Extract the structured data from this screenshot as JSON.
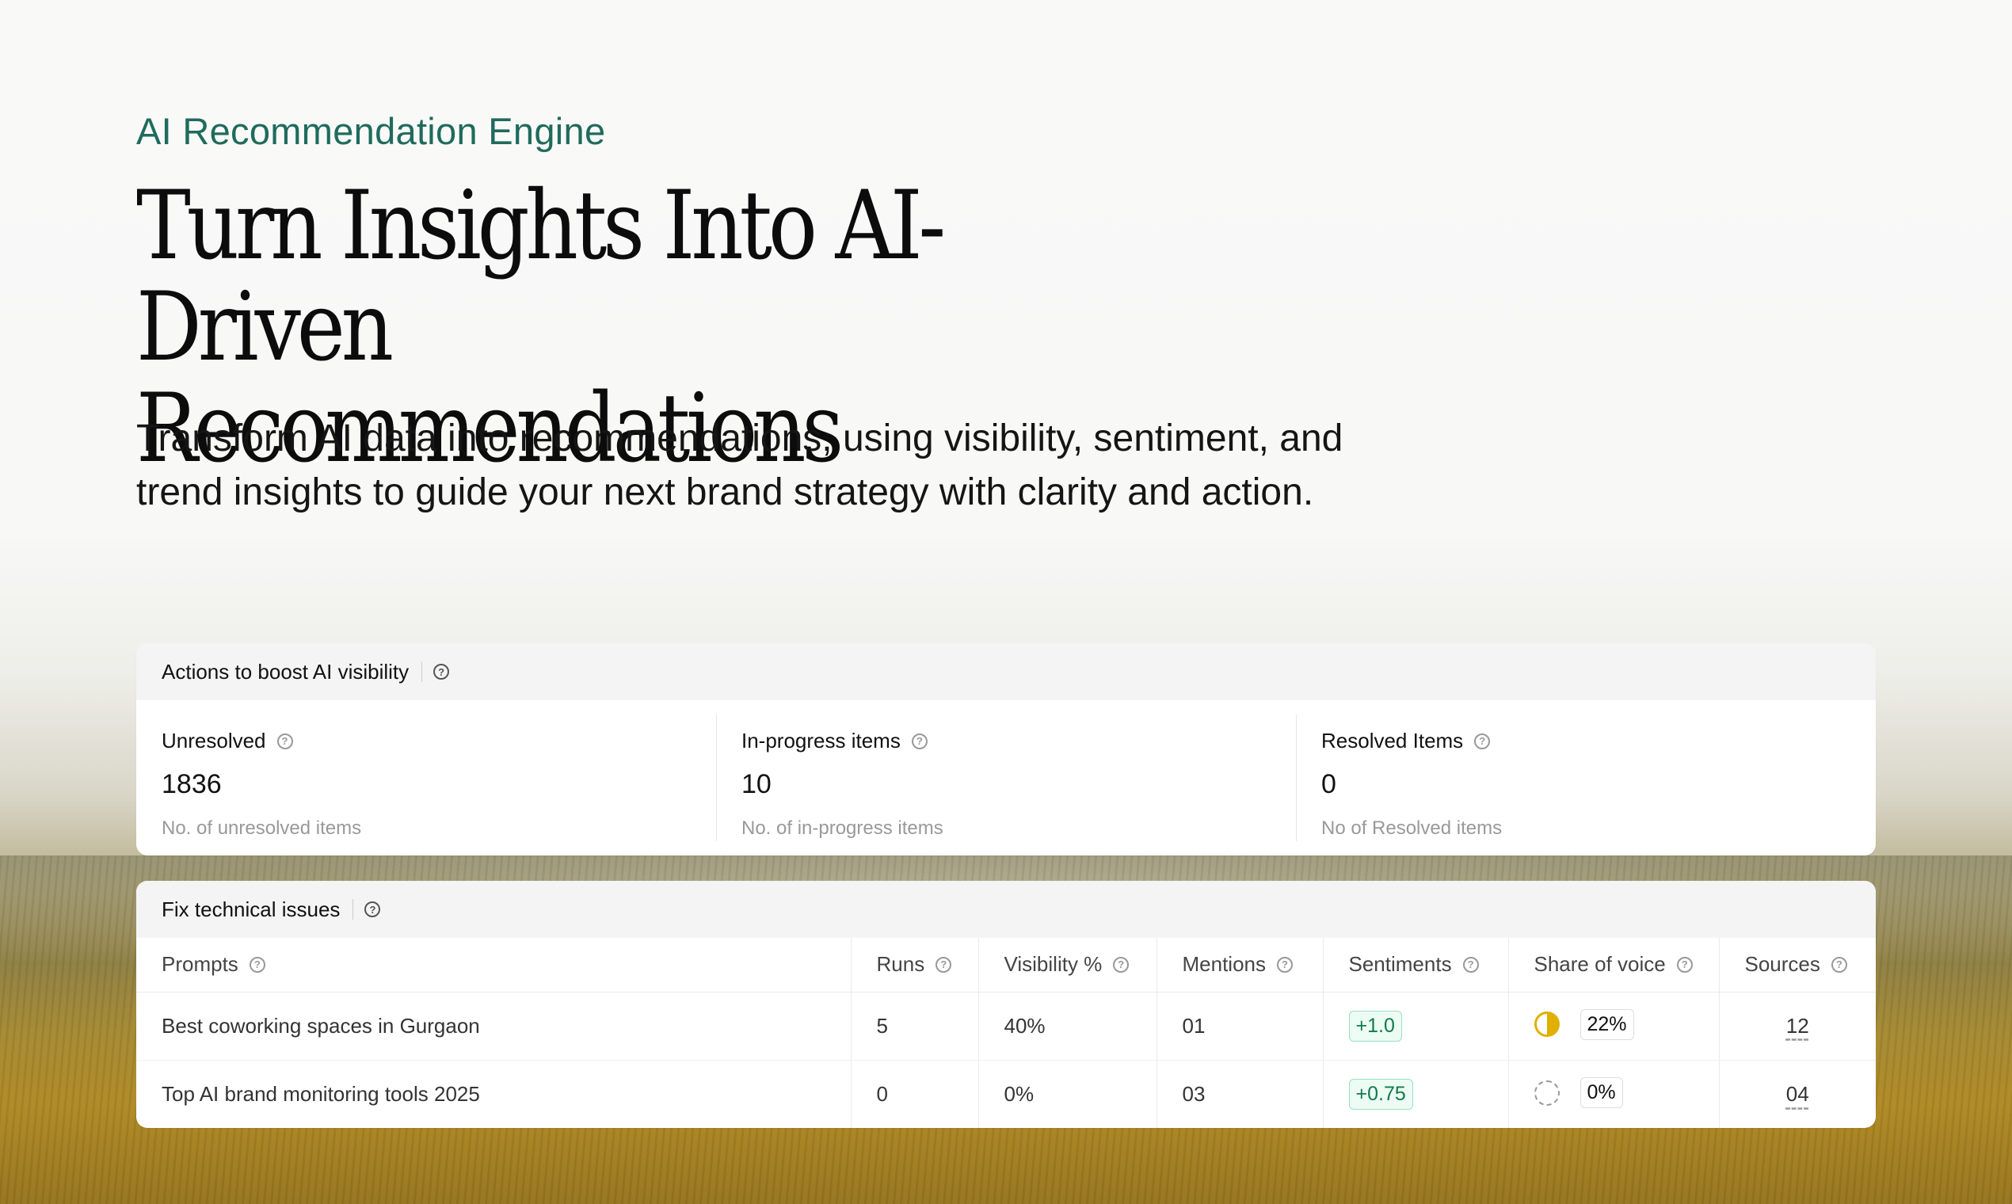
{
  "hero": {
    "eyebrow": "AI Recommendation Engine",
    "headline_line1": "Turn Insights Into AI-Driven",
    "headline_line2": "Recommendations",
    "subtitle_line1": "Transform AI data into recommendations, using visibility, sentiment, and",
    "subtitle_line2": "trend insights to guide your next brand strategy with clarity and action."
  },
  "actions_card": {
    "title": "Actions to boost AI visibility",
    "stats": [
      {
        "label": "Unresolved",
        "value": "1836",
        "desc": "No. of unresolved items"
      },
      {
        "label": "In-progress items",
        "value": "10",
        "desc": "No. of in-progress items"
      },
      {
        "label": "Resolved Items",
        "value": "0",
        "desc": "No of Resolved items"
      }
    ]
  },
  "issues_card": {
    "title": "Fix technical issues",
    "columns": [
      "Prompts",
      "Runs",
      "Visibility %",
      "Mentions",
      "Sentiments",
      "Share of voice",
      "Sources"
    ],
    "rows": [
      {
        "prompt": "Best coworking spaces in Gurgaon",
        "runs": "5",
        "visibility": "40%",
        "mentions": "01",
        "sentiment": "+1.0",
        "share_of_voice": "22%",
        "sources": "12"
      },
      {
        "prompt": "Top AI brand monitoring tools 2025",
        "runs": "0",
        "visibility": "0%",
        "mentions": "03",
        "sentiment": "+0.75",
        "share_of_voice": "0%",
        "sources": "04"
      }
    ]
  },
  "icons": {
    "help": "help-circle-icon",
    "sov_half": "half-pie-icon",
    "sov_empty": "empty-circle-icon"
  },
  "colors": {
    "accent": "#1f6b5c",
    "positive": "#127a4b",
    "sov": "#e0b000"
  }
}
